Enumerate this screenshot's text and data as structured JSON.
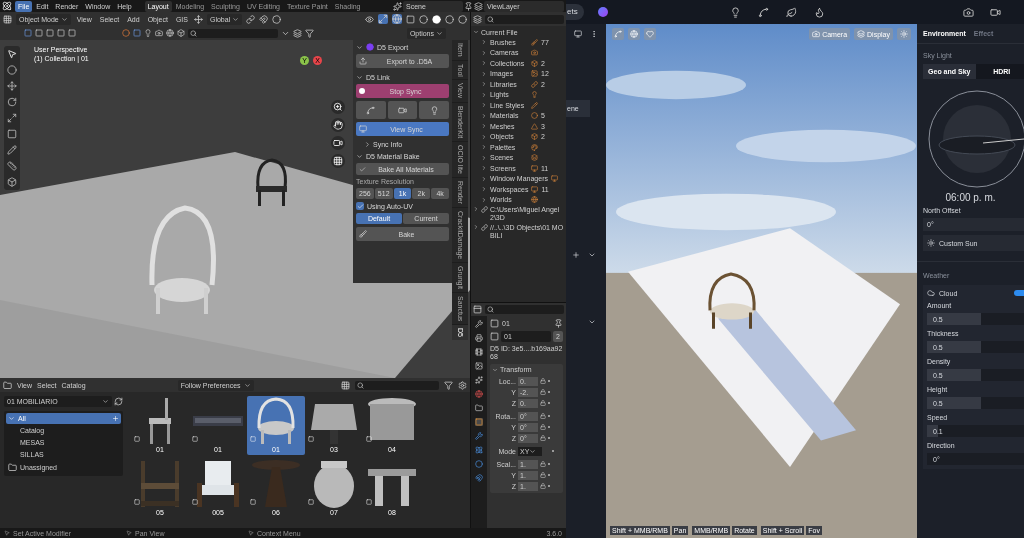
{
  "blender": {
    "menus": [
      {
        "label": "File",
        "selected": true
      },
      {
        "label": "Edit",
        "selected": false
      },
      {
        "label": "Render",
        "selected": false
      },
      {
        "label": "Window",
        "selected": false
      },
      {
        "label": "Help",
        "selected": false
      }
    ],
    "workspaces": [
      {
        "label": "Layout",
        "selected": true
      },
      {
        "label": "Modeling",
        "selected": false
      },
      {
        "label": "Sculpting",
        "selected": false
      },
      {
        "label": "UV Editing",
        "selected": false
      },
      {
        "label": "Texture Paint",
        "selected": false
      },
      {
        "label": "Shading",
        "selected": false
      }
    ],
    "scene": "Scene",
    "view_layer": "ViewLayer",
    "viewport_header": {
      "mode": "Object Mode",
      "menus": [
        "View",
        "Select",
        "Add",
        "Object",
        "GIS"
      ],
      "orientation": "Global"
    },
    "options": "Options",
    "viewport": {
      "view_name": "User Perspective",
      "collection": "(1) Collection | 01",
      "axes": [
        "Y",
        "X"
      ]
    },
    "sidebar_tabs": [
      {
        "label": "Item",
        "selected": false
      },
      {
        "label": "Tool",
        "selected": false
      },
      {
        "label": "View",
        "selected": false
      },
      {
        "label": "BlenderKit",
        "selected": false
      },
      {
        "label": "OCIO lite",
        "selected": false
      },
      {
        "label": "Render",
        "selected": false
      },
      {
        "label": "CrackitDamage",
        "selected": false
      },
      {
        "label": "Grungit",
        "selected": false
      },
      {
        "label": "Sanctus",
        "selected": false
      },
      {
        "label": "D5",
        "selected": true
      }
    ],
    "d5_export": {
      "title": "D5 Export",
      "button": "Export to .D5A"
    },
    "d5_link": {
      "title": "D5 Link",
      "stop": "Stop Sync",
      "view": "View Sync",
      "sync_info": "Sync Info"
    },
    "material_bake": {
      "title": "D5 Material Bake",
      "bake_all": "Bake All Materials",
      "resolution_label": "Texture Resolution",
      "resolutions": [
        {
          "label": "256",
          "selected": false
        },
        {
          "label": "512",
          "selected": false
        },
        {
          "label": "1k",
          "selected": true
        },
        {
          "label": "2k",
          "selected": false
        },
        {
          "label": "4k",
          "selected": false
        }
      ],
      "auto_uv": {
        "label": "Using Auto-UV",
        "checked": true
      },
      "modes": [
        {
          "label": "Default",
          "selected": true
        },
        {
          "label": "Current",
          "selected": false
        }
      ],
      "bake": "Bake"
    },
    "outliner": {
      "root": "Current File",
      "items": [
        {
          "label": "Brushes",
          "count": "77"
        },
        {
          "label": "Cameras"
        },
        {
          "label": "Collections",
          "count": "2"
        },
        {
          "label": "Images",
          "count": "12"
        },
        {
          "label": "Libraries",
          "count": "2"
        },
        {
          "label": "Lights"
        },
        {
          "label": "Line Styles"
        },
        {
          "label": "Materials",
          "count": "5"
        },
        {
          "label": "Meshes",
          "count": "3"
        },
        {
          "label": "Objects",
          "count": "2"
        },
        {
          "label": "Palettes"
        },
        {
          "label": "Scenes"
        },
        {
          "label": "Screens",
          "count": "11"
        },
        {
          "label": "Window Managers"
        },
        {
          "label": "Workspaces",
          "count": "11"
        },
        {
          "label": "Worlds"
        }
      ],
      "libraries": [
        "C:\\Users\\Miguel Angel 2\\3D",
        "//..\\..\\3D Objects\\01 MOBILI"
      ]
    },
    "properties": {
      "object": "01",
      "data_name": "01",
      "users": "2",
      "d5_id": "D5 ID: 3e5....b169aa9268",
      "panel": "Transform",
      "rows": [
        {
          "label": "Loc...",
          "value": "0.",
          "kind": "field"
        },
        {
          "label": "Y",
          "value": "-2.",
          "kind": "field"
        },
        {
          "label": "Z",
          "value": "0.",
          "kind": "field"
        },
        {
          "label": "Rota...",
          "value": "0°",
          "kind": "field"
        },
        {
          "label": "Y",
          "value": "0°",
          "kind": "field"
        },
        {
          "label": "Z",
          "value": "0°",
          "kind": "field"
        },
        {
          "label": "Mode",
          "value": "XY",
          "kind": "dropdown"
        },
        {
          "label": "Scal...",
          "value": "1.",
          "kind": "field"
        },
        {
          "label": "Y",
          "value": "1.",
          "kind": "field"
        },
        {
          "label": "Z",
          "value": "1.",
          "kind": "field"
        }
      ]
    },
    "asset_browser": {
      "menus": [
        "View",
        "Select",
        "Catalog"
      ],
      "import_method": "Follow Preferences",
      "library": "01 MOBILIARIO",
      "catalog": {
        "label": "All",
        "selected": true,
        "children": [
          {
            "label": "Catalog"
          },
          {
            "label": "MESAS"
          },
          {
            "label": "SILLAS"
          }
        ]
      },
      "unassigned": "Unassigned",
      "assets": [
        {
          "label": "01",
          "selected": false
        },
        {
          "label": "01",
          "selected": false
        },
        {
          "label": "01",
          "selected": true
        },
        {
          "label": "03",
          "selected": false
        },
        {
          "label": "04",
          "selected": false
        },
        {
          "label": "05",
          "selected": false
        },
        {
          "label": "005",
          "selected": false
        },
        {
          "label": "06",
          "selected": false
        },
        {
          "label": "07",
          "selected": false
        },
        {
          "label": "08",
          "selected": false
        }
      ]
    },
    "status_bar": {
      "hints": [
        "Set Active Modifier",
        "Pan View",
        "Context Menu"
      ],
      "version": "3.6.0"
    }
  },
  "d5": {
    "assets_button": "ets",
    "scene_item": "ene",
    "viewport_buttons": [
      "Camera",
      "Display"
    ],
    "hints": [
      {
        "keys": "Shift + MMB/RMB",
        "action": "Pan"
      },
      {
        "keys": "MMB/RMB",
        "action": "Rotate"
      },
      {
        "keys": "Shift + Scroll",
        "action": "Fov"
      }
    ],
    "panel": {
      "tabs": [
        {
          "label": "Environment",
          "selected": true
        },
        {
          "label": "Effect",
          "selected": false
        }
      ],
      "sky_light": "Sky Light",
      "sky_modes": [
        {
          "label": "Geo and Sky",
          "selected": true
        },
        {
          "label": "HDRI",
          "selected": false
        }
      ],
      "time": "06:00 p. m.",
      "north_offset": {
        "label": "North Offset",
        "value": "0°"
      },
      "custom_sun": "Custom Sun",
      "weather": "Weather",
      "cloud": {
        "label": "Cloud",
        "on": true
      },
      "sliders": [
        {
          "label": "Amount",
          "value": "0.5",
          "level": 0.5
        },
        {
          "label": "Thickness",
          "value": "0.5",
          "level": 0.5
        },
        {
          "label": "Density",
          "value": "0.5",
          "level": 0.5
        },
        {
          "label": "Height",
          "value": "0.5",
          "level": 0.5
        },
        {
          "label": "Speed",
          "value": "0.1",
          "level": 0.1
        },
        {
          "label": "Direction",
          "value": "0°",
          "level": 0
        }
      ]
    }
  }
}
